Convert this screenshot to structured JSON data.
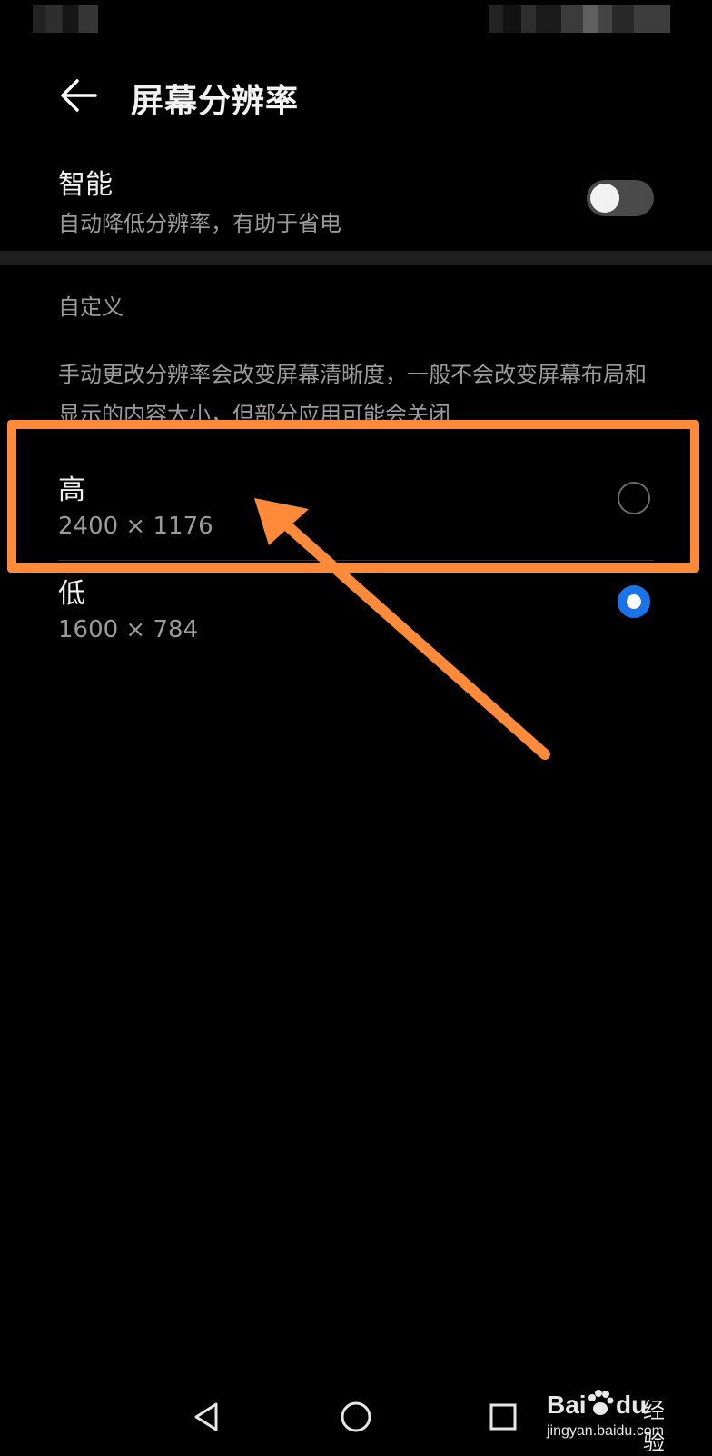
{
  "header": {
    "title": "屏幕分辨率"
  },
  "smart": {
    "title": "智能",
    "subtitle": "自动降低分辨率，有助于省电",
    "enabled": false
  },
  "custom": {
    "section_label": "自定义",
    "description": "手动更改分辨率会改变屏幕清晰度，一般不会改变屏幕布局和显示的内容大小，但部分应用可能会关闭",
    "options": [
      {
        "label": "高",
        "resolution": "2400 × 1176",
        "selected": false
      },
      {
        "label": "低",
        "resolution": "1600 × 784",
        "selected": true
      }
    ]
  },
  "colors": {
    "accent": "#1a73e8",
    "annotation": "#ff8a3a",
    "background": "#000000"
  },
  "icons": {
    "back": "arrow-left-icon",
    "nav_back": "triangle-back-icon",
    "nav_home": "circle-home-icon",
    "nav_recent": "square-recent-icon"
  },
  "watermark": {
    "brand": "Bai",
    "brand_suffix": "du",
    "site_cn": "经验",
    "url": "jingyan.baidu.com"
  }
}
